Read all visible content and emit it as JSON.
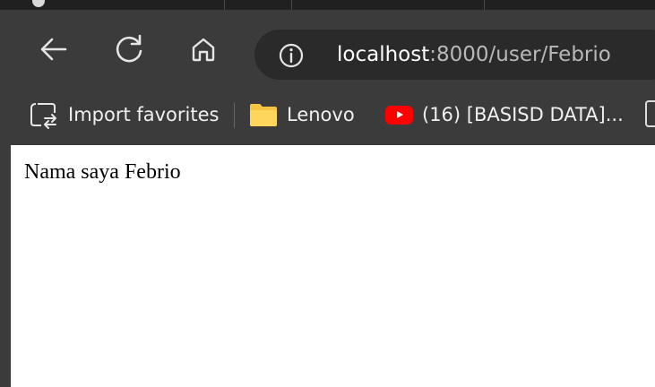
{
  "browser": {
    "address_bar": {
      "url_host": "localhost",
      "url_path": ":8000/user/Febrio"
    },
    "bookmarks": [
      {
        "label": "Import favorites",
        "icon": "import-favorites-icon"
      },
      {
        "label": "Lenovo",
        "icon": "folder-icon"
      },
      {
        "label": "(16) [BASISD DATA]...",
        "icon": "youtube-icon"
      }
    ]
  },
  "page": {
    "text": "Nama saya Febrio"
  },
  "colors": {
    "chrome_bg": "#3b3b3b",
    "omnibox_bg": "#2a2a2a",
    "folder": "#f6c343",
    "youtube": "#ff0000"
  }
}
